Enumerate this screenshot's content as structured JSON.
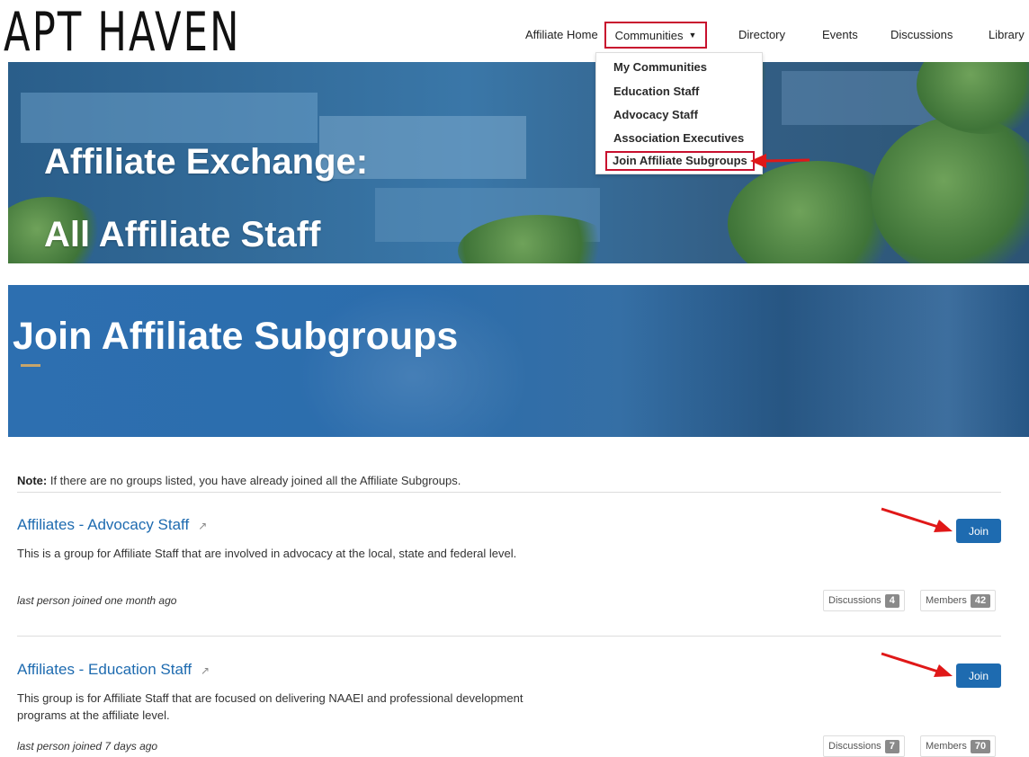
{
  "brand": {
    "logo_text": "APT HAVEN"
  },
  "nav": {
    "items": [
      "Affiliate Home",
      "Communities",
      "Directory",
      "Events",
      "Discussions",
      "Library"
    ]
  },
  "dropdown": {
    "items": [
      "My Communities",
      "Education Staff",
      "Advocacy Staff",
      "Association Executives",
      "Join Affiliate Subgroups"
    ],
    "active": "Join Affiliate Subgroups"
  },
  "hero": {
    "line1": "Affiliate Exchange:",
    "line2": "All Affiliate Staff"
  },
  "page": {
    "title": "Join Affiliate Subgroups",
    "note_label": "Note:",
    "note_text": " If there are no groups listed, you have already joined all the Affiliate Subgroups."
  },
  "groups": [
    {
      "title": "Affiliates - Advocacy Staff",
      "description": "This is a group for Affiliate Staff that are involved in advocacy at the local, state and federal level.",
      "last_joined": "last person joined one month ago",
      "join_label": "Join",
      "discussions_label": "Discussions",
      "discussions_count": "4",
      "members_label": "Members",
      "members_count": "42"
    },
    {
      "title": "Affiliates - Education Staff",
      "description": "This group is for Affiliate Staff that are focused on delivering NAAEI and professional development programs at the affiliate level.",
      "last_joined": "last person joined 7 days ago",
      "join_label": "Join",
      "discussions_label": "Discussions",
      "discussions_count": "7",
      "members_label": "Members",
      "members_count": "70"
    }
  ],
  "colors": {
    "accent": "#1e6bb0",
    "highlight": "#c8102e",
    "badge": "#8a8a8a"
  }
}
